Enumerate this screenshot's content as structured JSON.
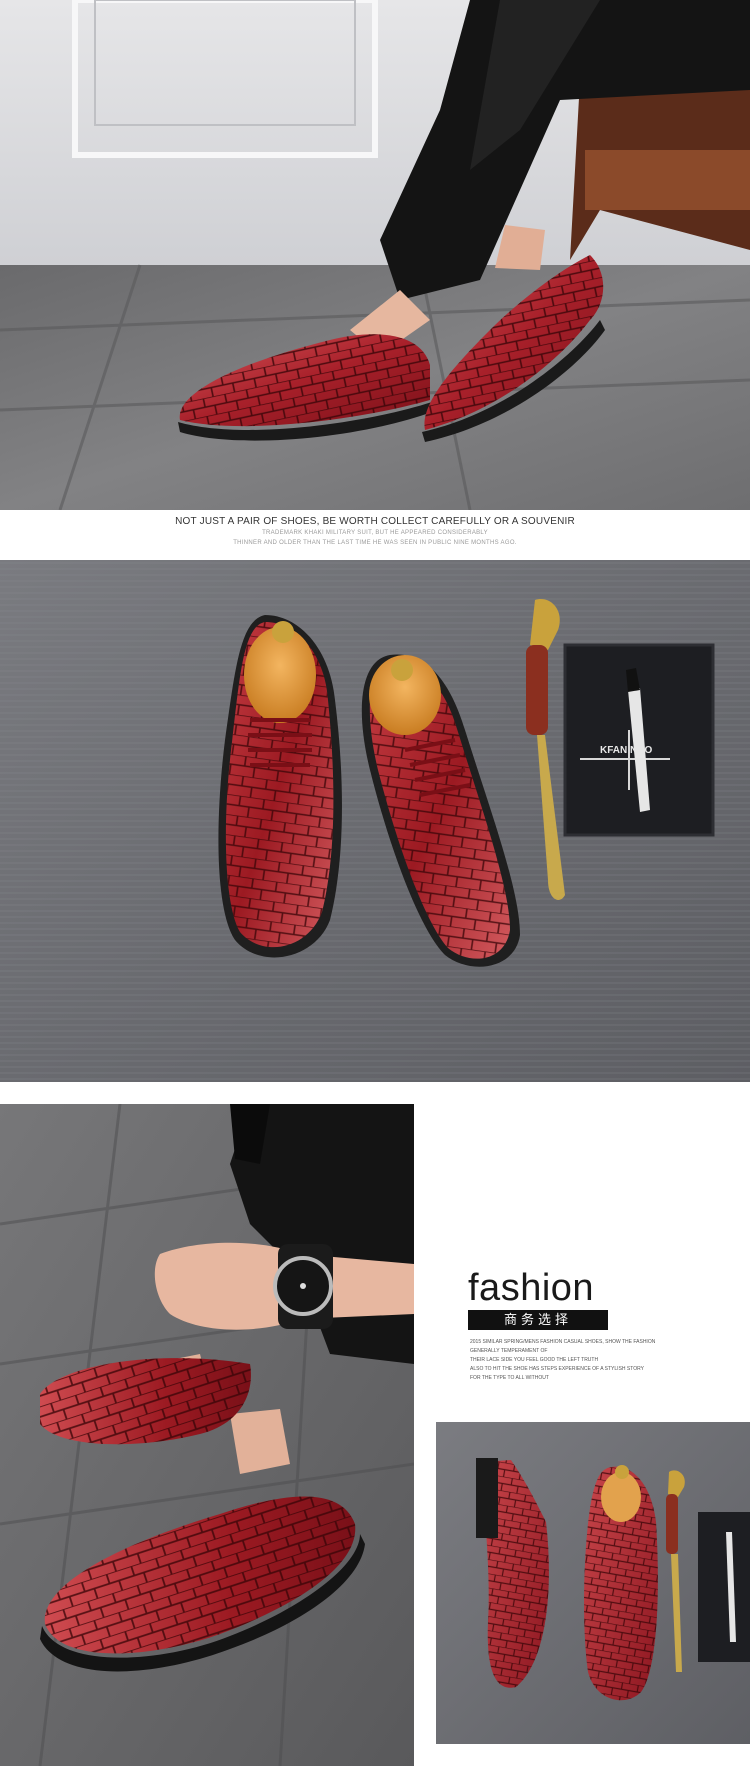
{
  "banner": {
    "headline": "NOT JUST A PAIR OF SHOES, BE WORTH COLLECT CAREFULLY OR A SOUVENIR",
    "sub_line_1": "TRADEMARK KHAKI MILITARY SUIT, BUT HE APPEARED CONSIDERABLY",
    "sub_line_2": "THINNER AND OLDER THAN THE LAST TIME HE WAS SEEN IN PUBLIC NINE MONTHS AGO."
  },
  "gift_box": {
    "brand_text": "KFAN NBO"
  },
  "fashion_panel": {
    "title": "fashion",
    "subtitle_cn": "商务选择",
    "fine_print": [
      "2015 SIMILAR SPRING/MENS FASHION CASUAL SHOES, SHOW THE FASHION",
      "GENERALLY TEMPERAMENT OF",
      "THEIR LACE SIDE YOU FEEL GOOD THE LEFT TRUTH",
      "ALSO TO HIT THE SHOE HAS STEPS EXPERIENCE OF A STYLISH STORY",
      "FOR THE TYPE TO ALL WITHOUT"
    ]
  },
  "colors": {
    "leather_red": "#9c1a22",
    "leather_highlight": "#d24a4f",
    "floor_gray": "#5f5f62",
    "backdrop_gray": "#6d6e73"
  }
}
